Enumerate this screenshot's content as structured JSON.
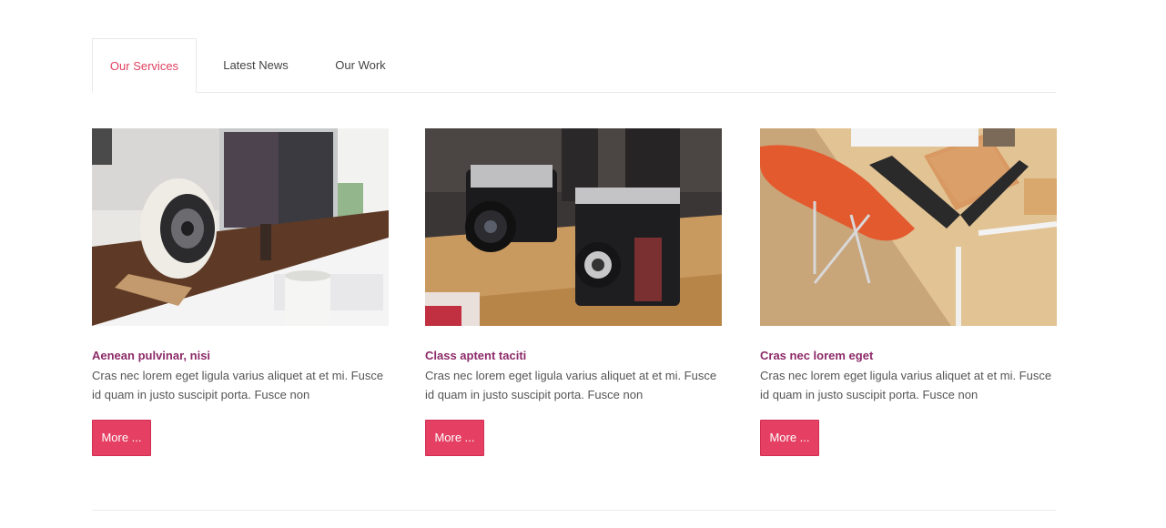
{
  "tabs": [
    {
      "label": "Our Services",
      "active": true
    },
    {
      "label": "Latest News",
      "active": false
    },
    {
      "label": "Our Work",
      "active": false
    }
  ],
  "cards": [
    {
      "image": "desk-speaker-photo",
      "title": "Aenean pulvinar, nisi",
      "description": "Cras nec lorem eget ligula varius aliquet at et mi. Fusce id quam in justo suscipit porta. Fusce non",
      "button": "More ..."
    },
    {
      "image": "vintage-cameras-photo",
      "title": "Class aptent taciti",
      "description": "Cras nec lorem eget ligula varius aliquet at et mi. Fusce id quam in justo suscipit porta. Fusce non",
      "button": "More ..."
    },
    {
      "image": "wooden-desk-chair-photo",
      "title": "Cras nec lorem eget",
      "description": "Cras nec lorem eget ligula varius aliquet at et mi. Fusce id quam in justo suscipit porta. Fusce non",
      "button": "More ..."
    }
  ],
  "colors": {
    "accent": "#e54063",
    "active_tab": "#e04160",
    "title": "#8c2a68",
    "text": "#555555"
  }
}
